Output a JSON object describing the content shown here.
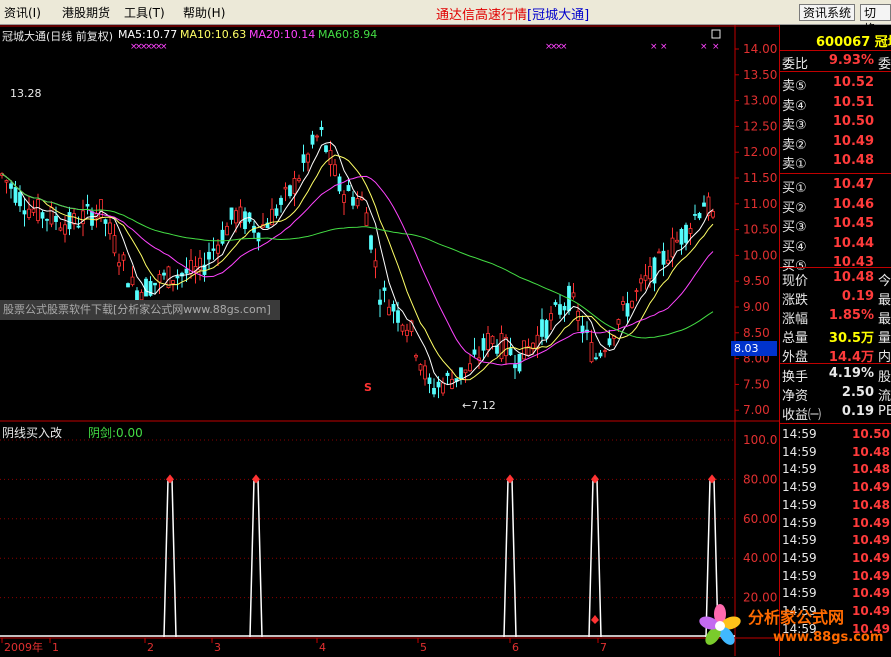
{
  "menu": {
    "items": [
      "资讯(I)",
      "港股期货",
      "工具(T)",
      "帮助(H)"
    ],
    "app_title": "通达信高速行情",
    "app_subtitle": "[冠城大通]",
    "btn_news": "资讯系统",
    "btn_switch": "切换"
  },
  "main_chart": {
    "title": "冠城大通(日线 前复权)",
    "ma5": "MA5:10.77",
    "ma10": "MA10:10.63",
    "ma20": "MA20:10.14",
    "ma60": "MA60:8.94",
    "y_ticks": [
      "14.00",
      "13.50",
      "13.00",
      "12.50",
      "12.00",
      "11.50",
      "11.00",
      "10.50",
      "10.00",
      "9.50",
      "9.00",
      "8.50",
      "8.00",
      "7.50",
      "7.00"
    ],
    "high_label": "13.28",
    "low_label": "←7.12",
    "current_price_tag": "8.03",
    "s_marker": "S",
    "watermark": "股票公式股票软件下载[分析家公式网www.88gs.com]",
    "colors": {
      "up": "#FF3333",
      "down": "#54FCFC",
      "ma5": "#FFFFFF",
      "ma10": "#FFFF66",
      "ma20": "#FF44FF",
      "ma60": "#44DD44"
    }
  },
  "indicator": {
    "title": "阴线买入改",
    "value_label": "阴剑:0.00",
    "y_ticks": [
      "100.0",
      "80.00",
      "60.00",
      "40.00",
      "20.00"
    ]
  },
  "x_axis": {
    "labels": [
      "2009年",
      "1",
      "2",
      "3",
      "4",
      "5",
      "6",
      "7"
    ]
  },
  "quote_panel": {
    "code": "600067",
    "name": "冠城",
    "weibi_label": "委比",
    "weibi_value": "9.93%",
    "weibi_extra": "委",
    "asks": [
      {
        "label": "卖⑤",
        "price": "10.52"
      },
      {
        "label": "卖④",
        "price": "10.51"
      },
      {
        "label": "卖③",
        "price": "10.50"
      },
      {
        "label": "卖②",
        "price": "10.49"
      },
      {
        "label": "卖①",
        "price": "10.48"
      }
    ],
    "bids": [
      {
        "label": "买①",
        "price": "10.47"
      },
      {
        "label": "买②",
        "price": "10.46"
      },
      {
        "label": "买③",
        "price": "10.45"
      },
      {
        "label": "买④",
        "price": "10.44"
      },
      {
        "label": "买⑤",
        "price": "10.43"
      }
    ],
    "stats": [
      {
        "label": "现价",
        "value": "10.48",
        "extra": "今",
        "color": "#FF3B3B"
      },
      {
        "label": "涨跌",
        "value": "0.19",
        "extra": "最",
        "color": "#FF3B3B"
      },
      {
        "label": "涨幅",
        "value": "1.85%",
        "extra": "最",
        "color": "#FF3B3B"
      },
      {
        "label": "总量",
        "value": "30.5万",
        "extra": "量",
        "color": "#FFFF00"
      },
      {
        "label": "外盘",
        "value": "14.4万",
        "extra": "内",
        "color": "#FF3B3B"
      }
    ],
    "stats2": [
      {
        "label": "换手",
        "value": "4.19%",
        "extra": "股",
        "color": "#E8E8E8"
      },
      {
        "label": "净资",
        "value": "2.50",
        "extra": "流",
        "color": "#E8E8E8"
      },
      {
        "label": "收益㈠",
        "value": "0.19",
        "extra": "PE",
        "color": "#E8E8E8"
      }
    ],
    "ticks": [
      {
        "time": "14:59",
        "price": "10.50"
      },
      {
        "time": "14:59",
        "price": "10.48"
      },
      {
        "time": "14:59",
        "price": "10.48"
      },
      {
        "time": "14:59",
        "price": "10.49"
      },
      {
        "time": "14:59",
        "price": "10.48"
      },
      {
        "time": "14:59",
        "price": "10.49"
      },
      {
        "time": "14:59",
        "price": "10.49"
      },
      {
        "time": "14:59",
        "price": "10.49"
      },
      {
        "time": "14:59",
        "price": "10.49"
      },
      {
        "time": "14:59",
        "price": "10.49"
      },
      {
        "time": "14:59",
        "price": "10.49"
      },
      {
        "time": "14:59",
        "price": "10.49"
      }
    ]
  },
  "logo": {
    "text": "分析家公式网",
    "url": "www.88gs.com"
  }
}
